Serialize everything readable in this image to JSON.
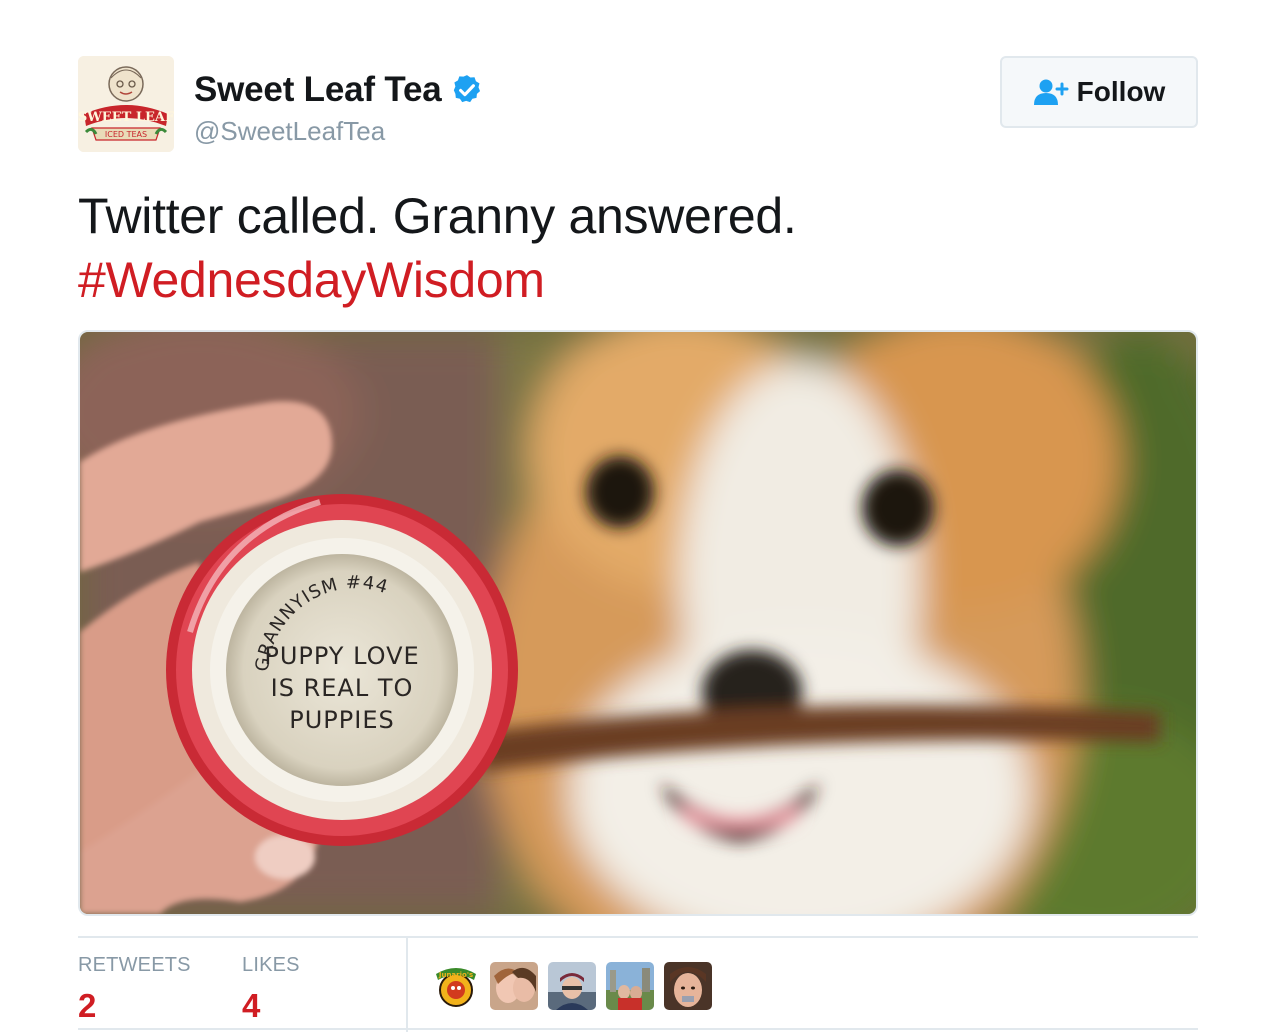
{
  "account": {
    "display_name": "Sweet Leaf Tea",
    "handle": "@SweetLeafTea",
    "verified": true,
    "avatar_logo_text": [
      "SWEET LEAF",
      "ICED TEAS"
    ]
  },
  "follow_button": {
    "label": "Follow",
    "icon": "add-user-icon"
  },
  "tweet": {
    "text": "Twitter called. Granny answered.",
    "hashtag": "#WednesdayWisdom"
  },
  "media": {
    "cap_text": {
      "arc": "GRANNYISM #44",
      "lines": [
        "PUPPY LOVE",
        "IS REAL TO",
        "PUPPIES"
      ]
    }
  },
  "stats": {
    "retweets_label": "RETWEETS",
    "retweets_count": "2",
    "likes_label": "LIKES",
    "likes_count": "4"
  },
  "likers": {
    "first_logo_text": "Junario's"
  },
  "colors": {
    "accent": "#d01d23",
    "verified": "#1da1f2",
    "muted": "#8899a6",
    "border": "#e1e8ed"
  }
}
